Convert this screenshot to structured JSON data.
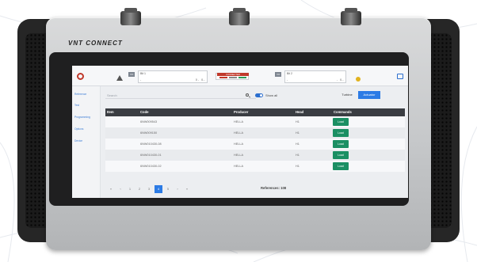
{
  "device": {
    "brand": "VNT CONNECT"
  },
  "topbar": {
    "sensor1": {
      "tag": "VO",
      "label": "Bit 1",
      "v1": "-",
      "v2": "0 -",
      "v3": "0..."
    },
    "status": {
      "label": "CONNECTED"
    },
    "sensor2": {
      "tag": "VO",
      "label": "Bit 2",
      "v1": "-",
      "v2": "-",
      "v3": "0..."
    }
  },
  "sidenav": {
    "items": [
      "Reference",
      "Test",
      "Programming",
      "Options",
      "Device"
    ]
  },
  "search": {
    "placeholder": "Search"
  },
  "show_all": "Show all",
  "tabs": [
    "Turbine",
    "Actuator"
  ],
  "table": {
    "headers": [
      "Item",
      "Code",
      "Producer",
      "Head",
      "Commands"
    ],
    "rows": [
      {
        "code": "6NW009543",
        "producer": "HELLA",
        "head": "H1",
        "cmd": "Load"
      },
      {
        "code": "6NW009150",
        "producer": "HELLA",
        "head": "H1",
        "cmd": "Load"
      },
      {
        "code": "6NW010430-08",
        "producer": "HELLA",
        "head": "H1",
        "cmd": "Load"
      },
      {
        "code": "6NW010430-01",
        "producer": "HELLA",
        "head": "H1",
        "cmd": "Load"
      },
      {
        "code": "6NW010430-02",
        "producer": "HELLA",
        "head": "H1",
        "cmd": "Load"
      }
    ]
  },
  "pagination": {
    "pages": [
      "«",
      "‹",
      "1",
      "2",
      "3",
      "4",
      "5",
      "›",
      "»"
    ],
    "active": "4"
  },
  "references": "References: 108"
}
